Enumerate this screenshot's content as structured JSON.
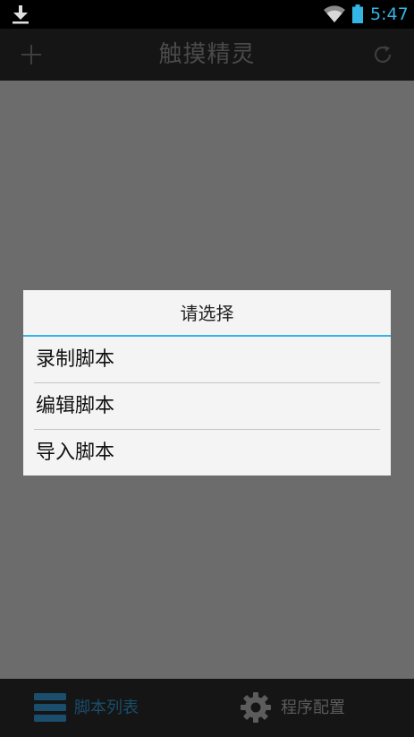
{
  "status_bar": {
    "time": "5:47",
    "icons": [
      "download-icon",
      "wifi-icon",
      "battery-icon"
    ],
    "accent_color": "#33b5e5"
  },
  "action_bar": {
    "title": "触摸精灵",
    "left_icon": "add-icon",
    "right_icon": "refresh-icon"
  },
  "dialog": {
    "title": "请选择",
    "options": [
      {
        "label": "录制脚本"
      },
      {
        "label": "编辑脚本"
      },
      {
        "label": "导入脚本"
      }
    ],
    "divider_color": "#33b5e5"
  },
  "tab_bar": {
    "tabs": [
      {
        "label": "脚本列表",
        "icon": "list-icon",
        "selected": true
      },
      {
        "label": "程序配置",
        "icon": "gear-icon",
        "selected": false
      }
    ]
  }
}
